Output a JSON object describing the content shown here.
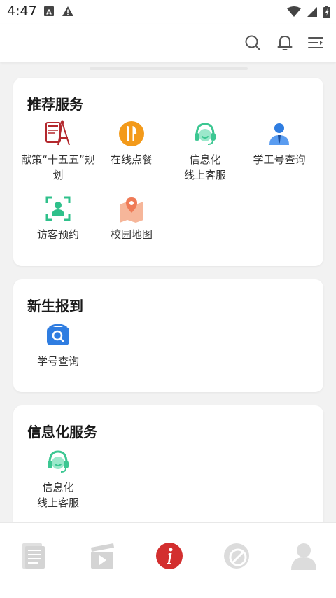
{
  "status_bar": {
    "time": "4:47",
    "left_icons": [
      "font-icon",
      "warning-icon"
    ],
    "right_icons": [
      "wifi-icon",
      "signal-icon",
      "battery-icon"
    ]
  },
  "top_bar": {
    "icons": [
      "search-icon",
      "bell-icon",
      "menu-icon"
    ]
  },
  "sections": [
    {
      "title": "推荐服务",
      "items": [
        {
          "label_lines": [
            "献策“十五五”规",
            "划"
          ],
          "icon": "plan-icon"
        },
        {
          "label_lines": [
            "在线点餐"
          ],
          "icon": "dining-icon"
        },
        {
          "label_lines": [
            "信息化",
            "线上客服"
          ],
          "icon": "headset-icon"
        },
        {
          "label_lines": [
            "学工号查询"
          ],
          "icon": "person-icon"
        },
        {
          "label_lines": [
            "访客预约"
          ],
          "icon": "visitor-scan-icon"
        },
        {
          "label_lines": [
            "校园地图"
          ],
          "icon": "map-icon"
        }
      ]
    },
    {
      "title": "新生报到",
      "items": [
        {
          "label_lines": [
            "学号查询"
          ],
          "icon": "id-search-icon"
        }
      ]
    },
    {
      "title": "信息化服务",
      "items": [
        {
          "label_lines": [
            "信息化",
            "线上客服"
          ],
          "icon": "headset-icon"
        }
      ]
    }
  ],
  "bottom_nav": {
    "items": [
      "news-icon",
      "video-icon",
      "info-icon",
      "blocked-icon",
      "profile-icon"
    ],
    "active": "info-icon",
    "active_color": "#d32f2f",
    "inactive_color": "#dcdcdc"
  }
}
